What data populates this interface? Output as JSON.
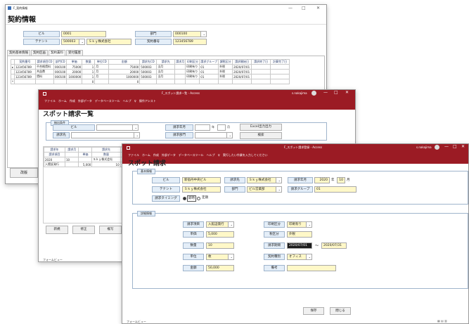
{
  "w1": {
    "title": "F_契約情報",
    "heading": "契約情報",
    "controls": [
      "—",
      "□",
      "✕"
    ],
    "fields": {
      "bill_label": "ビル",
      "bill_value": "0001",
      "tenant_label": "テナント",
      "tenant_value": "500003",
      "tenant_name": "Ｓｋｙ株式会社",
      "dept_label": "部門",
      "dept_value": "000100",
      "contract_label": "契約番号",
      "contract_value": "123456789"
    },
    "tabs": [
      "契約基本情報",
      "契約区画",
      "契約賃料",
      "受付履歴"
    ],
    "grid": {
      "headers": [
        "契約番号",
        "請求項目CD",
        "部門CD",
        "単価",
        "数量",
        "単位CD",
        "金額",
        "請求先CD",
        "請求先",
        "請求月",
        "印刷区分",
        "請求グループ",
        "課税区分",
        "請求開始日",
        "請求終了日",
        "計算完了日"
      ],
      "rows": [
        [
          "123456789",
          "不合格賃料",
          "000100",
          "75000",
          "1",
          "月",
          "75000",
          "500003",
          "当月",
          "",
          "印刷有り",
          "01",
          "外税",
          "2020/07/01",
          "",
          ""
        ],
        [
          "123456789",
          "共益費",
          "000100",
          "20000",
          "1",
          "月",
          "20000",
          "500003",
          "当月",
          "",
          "印刷有り",
          "01",
          "外税",
          "2020/07/01",
          "",
          ""
        ],
        [
          "123456789",
          "賃料",
          "000100",
          "1000000",
          "1",
          "月",
          "1000000",
          "500003",
          "当月",
          "",
          "印刷有り",
          "01",
          "外税",
          "2020/07/01",
          "",
          ""
        ]
      ],
      "new_row": {
        "qty": "0",
        "amount": "0"
      }
    },
    "button": "改版"
  },
  "w2": {
    "title": "F_スポット請求一覧 - Access",
    "user": "s.nakajima",
    "controls": [
      "—",
      "□",
      "✕"
    ],
    "menu": "ファイル　ホーム　作成　外部データ　データベースツール　ヘルプ　♀ 操作アシスト",
    "heading": "スポット請求一覧",
    "group": "抽出条件",
    "bill_label": "ビル",
    "month_label": "請求年月",
    "year_unit": "年",
    "month_unit": "月",
    "excel_button": "Excel出力出力",
    "dest_label": "請求先",
    "dept_label": "請求部門",
    "search_button": "検索",
    "list": {
      "headers": [
        "請求年",
        "請求月",
        "",
        "請求先",
        ""
      ],
      "sub_headers": [
        "請求項目",
        "",
        "単価",
        "数量",
        "単位"
      ],
      "rows": [
        [
          "2020",
          "10",
          "",
          "Ｓｋｙ株式会社",
          ""
        ],
        [
          "入館証発行",
          "",
          "5,000",
          "10",
          "枚"
        ]
      ]
    },
    "buttons": [
      "新規",
      "修正",
      "複写"
    ],
    "status": "フォームビュー"
  },
  "w3": {
    "title": "F_スポット請求登録 - Access",
    "user": "s.nakajima",
    "controls": [
      "—",
      "□",
      "✕"
    ],
    "menu": "ファイル　ホーム　作成　外部データ　データベースツール　ヘルプ　♀ 実行したい作業を入力してください",
    "heading": "スポット請求",
    "basic": {
      "caption": "基本情報",
      "bill_label": "ビル",
      "bill_value": "新宿丹中央ビル",
      "dest_label": "請求先",
      "dest_value": "Ｓｋｙ株式会社",
      "ym_label": "請求年月",
      "year": "2020",
      "year_unit": "年",
      "month": "10",
      "month_unit": "月",
      "tenant_label": "テナント",
      "tenant_value": "Ｓｋｙ株式会社",
      "dept_label": "部門",
      "dept_value": "ビル営業部",
      "group_label": "請求グループ",
      "group_value": "01",
      "timing_label": "請求タイミング",
      "timing_opt1": "即時",
      "timing_opt2": "定期"
    },
    "detail": {
      "caption": "詳細情報",
      "item_label": "請求項目",
      "item_value": "入館証発行",
      "print_label": "印刷区分",
      "print_value": "印刷有り",
      "unit_price_label": "単価",
      "unit_price_value": "5,000",
      "tax_label": "税区分",
      "tax_value": "外税",
      "qty_label": "数量",
      "qty_value": "10",
      "period_label": "請求期間",
      "period_from": "2020/07/01",
      "tilde": "〜",
      "period_to": "2020/07/31",
      "unit_label": "単位",
      "unit_value": "枚",
      "ctype_label": "契約種別",
      "ctype_value": "オフィス",
      "amount_label": "金額",
      "amount_value": "50,000",
      "note_label": "備考",
      "note_value": ""
    },
    "buttons": [
      "保存",
      "閉じる"
    ],
    "status": "フォームビュー"
  }
}
